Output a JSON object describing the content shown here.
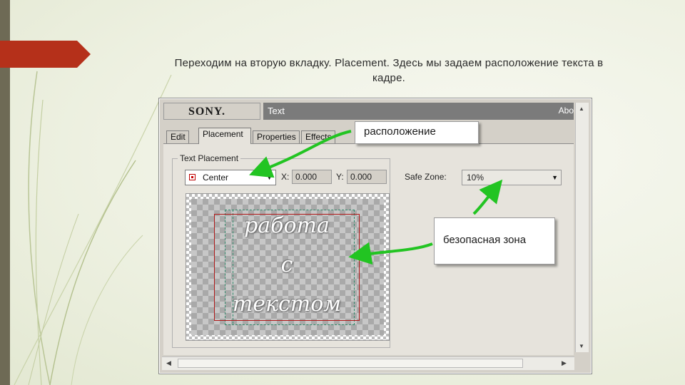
{
  "slide": {
    "caption_line1": "Переходим на вторую вкладку. Placement. Здесь мы задаем расположение текста в",
    "caption_line2": "кадре."
  },
  "window": {
    "logo": "SONY.",
    "title": "Text",
    "about": "Abo"
  },
  "tabs": [
    {
      "label": "Edit",
      "active": false
    },
    {
      "label": "Placement",
      "active": true
    },
    {
      "label": "Properties",
      "active": false
    },
    {
      "label": "Effects",
      "active": false
    }
  ],
  "placement": {
    "group_label": "Text Placement",
    "position_value": "Center",
    "x_label": "X:",
    "x_value": "0.000",
    "y_label": "Y:",
    "y_value": "0.000",
    "safe_zone_label": "Safe Zone:",
    "safe_zone_value": "10%"
  },
  "preview": {
    "line1": "работа",
    "line2": "с",
    "line3": "текстом"
  },
  "callouts": {
    "position": "расположение",
    "safe_zone": "безопасная зона"
  },
  "colors": {
    "accent_red": "#b5301a",
    "arrow_green": "#22c422",
    "sidebar": "#6e6a55"
  },
  "icons": {
    "dropdown": "chevron-down-icon",
    "scroll_up": "arrow-up-icon",
    "scroll_down": "arrow-down-icon",
    "scroll_left": "arrow-left-icon",
    "scroll_right": "arrow-right-icon"
  }
}
